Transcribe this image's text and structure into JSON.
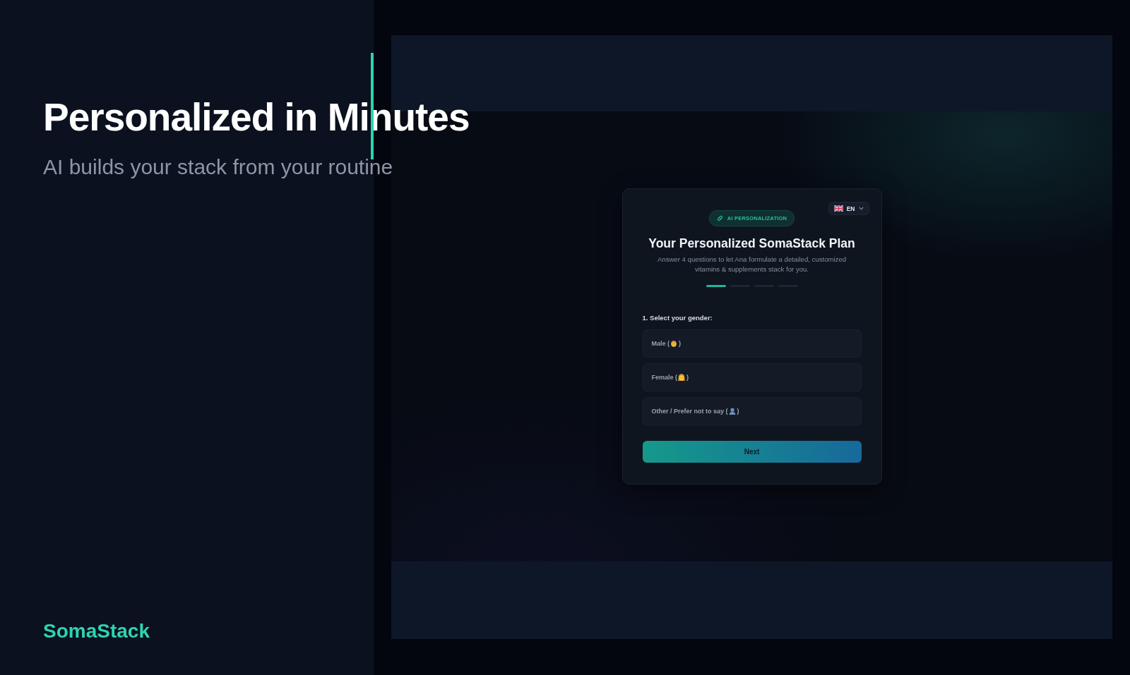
{
  "headline": {
    "title": "Personalized in Minutes",
    "subtitle": "AI builds your stack from your routine"
  },
  "brand": "SomaStack",
  "app": {
    "language": {
      "code": "EN"
    },
    "badge": "AI PERSONALIZATION",
    "title": "Your Personalized SomaStack Plan",
    "description": "Answer 4 questions to let Ana formulate a detailed, customized vitamins & supplements stack for you.",
    "progress": [
      {
        "active": true
      },
      {
        "active": false
      },
      {
        "active": false
      },
      {
        "active": false
      }
    ],
    "question": "1. Select your gender:",
    "options": [
      {
        "kind": "male",
        "text": "Male (",
        "suffix": ")",
        "selected": false
      },
      {
        "kind": "female",
        "text": "Female (",
        "suffix": ")",
        "selected": false
      },
      {
        "kind": "other",
        "text": "Other / Prefer not to say (",
        "suffix": ")",
        "selected": false
      }
    ],
    "next_button": "Next"
  }
}
